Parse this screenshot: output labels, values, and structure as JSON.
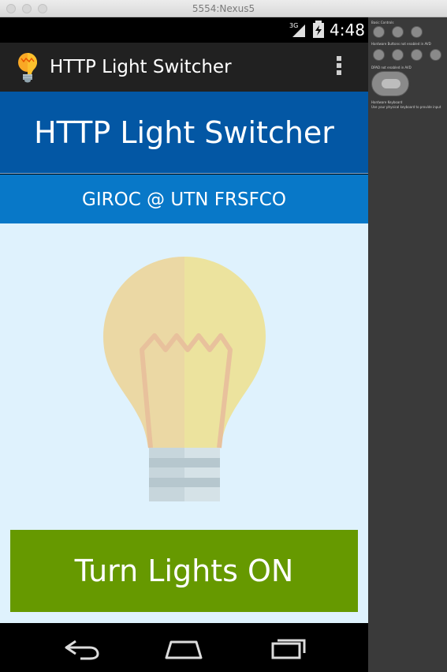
{
  "window": {
    "title": "5554:Nexus5"
  },
  "status_bar": {
    "network": "3G",
    "time": "4:48"
  },
  "action_bar": {
    "title": "HTTP Light Switcher",
    "app_icon": "lightbulb-icon",
    "menu_icon": "overflow-menu-icon"
  },
  "header": {
    "title": "HTTP Light Switcher"
  },
  "subheader": {
    "text": "GIROC @ UTN FRSFCO"
  },
  "main": {
    "bulb_icon": "lightbulb-icon",
    "button_label": "Turn Lights ON"
  },
  "nav_bar": {
    "back_icon": "back-icon",
    "home_icon": "home-icon",
    "recents_icon": "recents-icon"
  },
  "side_panel": {
    "basic_controls": "Basic Controls",
    "hardware_buttons": "Hardware Buttons not enabled in AVD",
    "dpad": "DPAD not enabled in AVD",
    "keyboard_title": "Hardware Keyboard",
    "keyboard_hint": "Use your physical keyboard to provide input"
  },
  "colors": {
    "header": "#0357a4",
    "subheader": "#0878c8",
    "content_bg": "#dff2fd",
    "button": "#669900",
    "action_bar": "#212121"
  }
}
